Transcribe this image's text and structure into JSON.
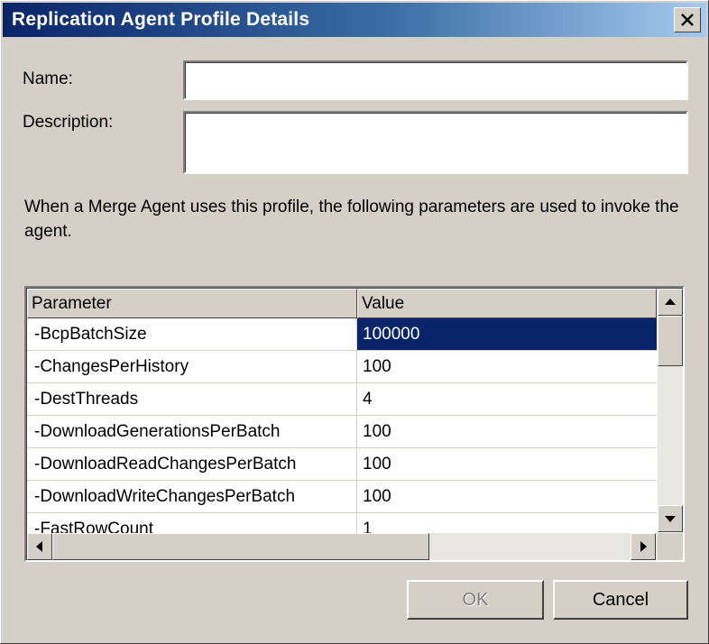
{
  "window": {
    "title": "Replication Agent Profile Details"
  },
  "form": {
    "name_label": "Name:",
    "name_value": "",
    "description_label": "Description:",
    "description_value": ""
  },
  "info_text": "When a Merge Agent uses this profile, the following parameters are used to invoke the agent.",
  "grid": {
    "headers": [
      "Parameter",
      "Value"
    ],
    "rows": [
      {
        "param": "-BcpBatchSize",
        "value": "100000"
      },
      {
        "param": "-ChangesPerHistory",
        "value": "100"
      },
      {
        "param": "-DestThreads",
        "value": "4"
      },
      {
        "param": "-DownloadGenerationsPerBatch",
        "value": "100"
      },
      {
        "param": "-DownloadReadChangesPerBatch",
        "value": "100"
      },
      {
        "param": "-DownloadWriteChangesPerBatch",
        "value": "100"
      },
      {
        "param": "-FastRowCount",
        "value": "1"
      }
    ],
    "selected_row": 0
  },
  "buttons": {
    "ok": "OK",
    "cancel": "Cancel"
  },
  "icons": {
    "close": "close-icon",
    "scroll_up": "arrow-up-icon",
    "scroll_down": "arrow-down-icon",
    "scroll_left": "arrow-left-icon",
    "scroll_right": "arrow-right-icon"
  },
  "colors": {
    "title_start": "#0a246a",
    "title_end": "#a6caf0",
    "selection": "#0a246a",
    "face": "#d4d0c8"
  }
}
